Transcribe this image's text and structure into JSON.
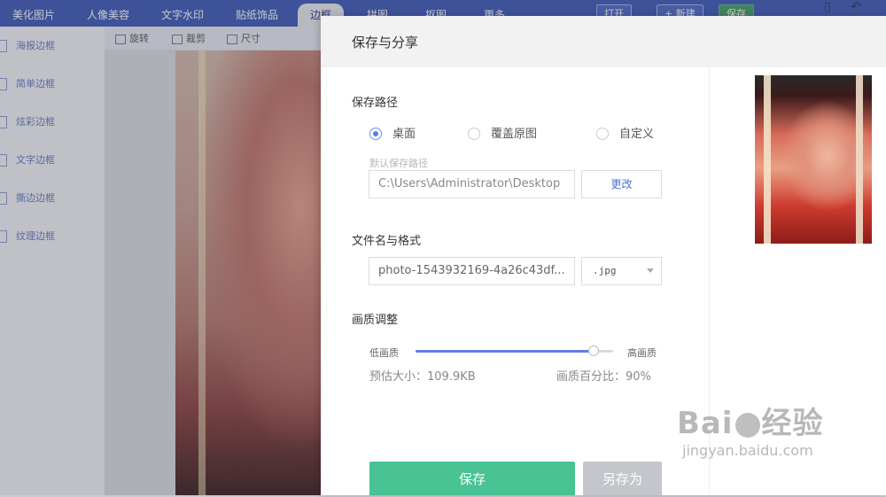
{
  "topbar": {
    "tabs": [
      {
        "label": "美化图片"
      },
      {
        "label": "人像美容"
      },
      {
        "label": "文字水印"
      },
      {
        "label": "贴纸饰品"
      },
      {
        "label": "边框"
      },
      {
        "label": "拼图"
      },
      {
        "label": "抠图"
      },
      {
        "label": "更多"
      }
    ],
    "open_label": "打开",
    "new_label": "+ 新建",
    "save_label": "保存"
  },
  "sidebar": {
    "items": [
      {
        "label": "海报边框"
      },
      {
        "label": "简单边框"
      },
      {
        "label": "炫彩边框"
      },
      {
        "label": "文字边框"
      },
      {
        "label": "撕边边框"
      },
      {
        "label": "纹理边框"
      }
    ]
  },
  "tools": {
    "rotate_label": "旋转",
    "crop_label": "裁剪",
    "size_label": "尺寸"
  },
  "dialog": {
    "title": "保存与分享",
    "path_section": "保存路径",
    "radio_desktop": "桌面",
    "radio_overwrite": "覆盖原图",
    "radio_custom": "自定义",
    "default_path_hint": "默认保存路径",
    "path_value": "C:\\Users\\Administrator\\Desktop",
    "change_button": "更改",
    "filename_section": "文件名与格式",
    "filename_value": "photo-1543932169-4a26c43df...",
    "format_value": ".jpg",
    "quality_section": "画质调整",
    "low_quality": "低画质",
    "high_quality": "高画质",
    "quality_fraction": 0.9,
    "estimated_size": "预估大小：109.9KB",
    "quality_percent": "画质百分比：90%",
    "save_button": "保存",
    "save_as_button": "另存为"
  },
  "watermark": {
    "logo_text_a": "Bai",
    "logo_text_b": "经验",
    "site": "jingyan.baidu.com"
  },
  "colors": {
    "brand_blue": "#3b57b5",
    "save_green": "#49c294",
    "slider_blue": "#5f7fe6"
  }
}
